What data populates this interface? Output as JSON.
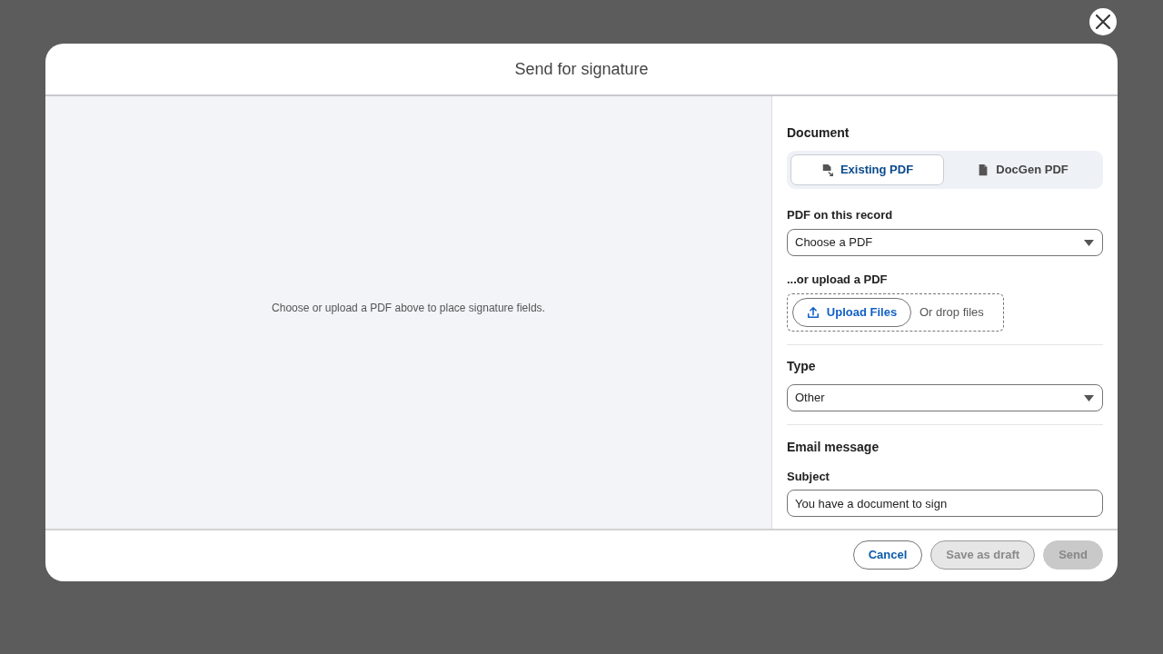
{
  "dialog": {
    "title": "Send for signature"
  },
  "preview": {
    "message": "Choose or upload a PDF above to place signature fields."
  },
  "document_section": {
    "heading": "Document",
    "tabs": [
      {
        "label": "Existing PDF",
        "selected": true
      },
      {
        "label": "DocGen PDF",
        "selected": false
      }
    ]
  },
  "pdf_on_record": {
    "label": "PDF on this record",
    "value": "Choose a PDF"
  },
  "upload": {
    "label": "...or upload a PDF",
    "button": "Upload Files",
    "hint": "Or drop files"
  },
  "type_field": {
    "heading": "Type",
    "value": "Other"
  },
  "email_message": {
    "heading": "Email message",
    "subject": {
      "label": "Subject",
      "value": "You have a document to sign"
    }
  },
  "footer_buttons": [
    {
      "label": "Cancel",
      "kind": "outline",
      "disabled": false
    },
    {
      "label": "Save as draft",
      "kind": "outline",
      "disabled": true
    },
    {
      "label": "Send",
      "kind": "brand",
      "disabled": true
    }
  ]
}
